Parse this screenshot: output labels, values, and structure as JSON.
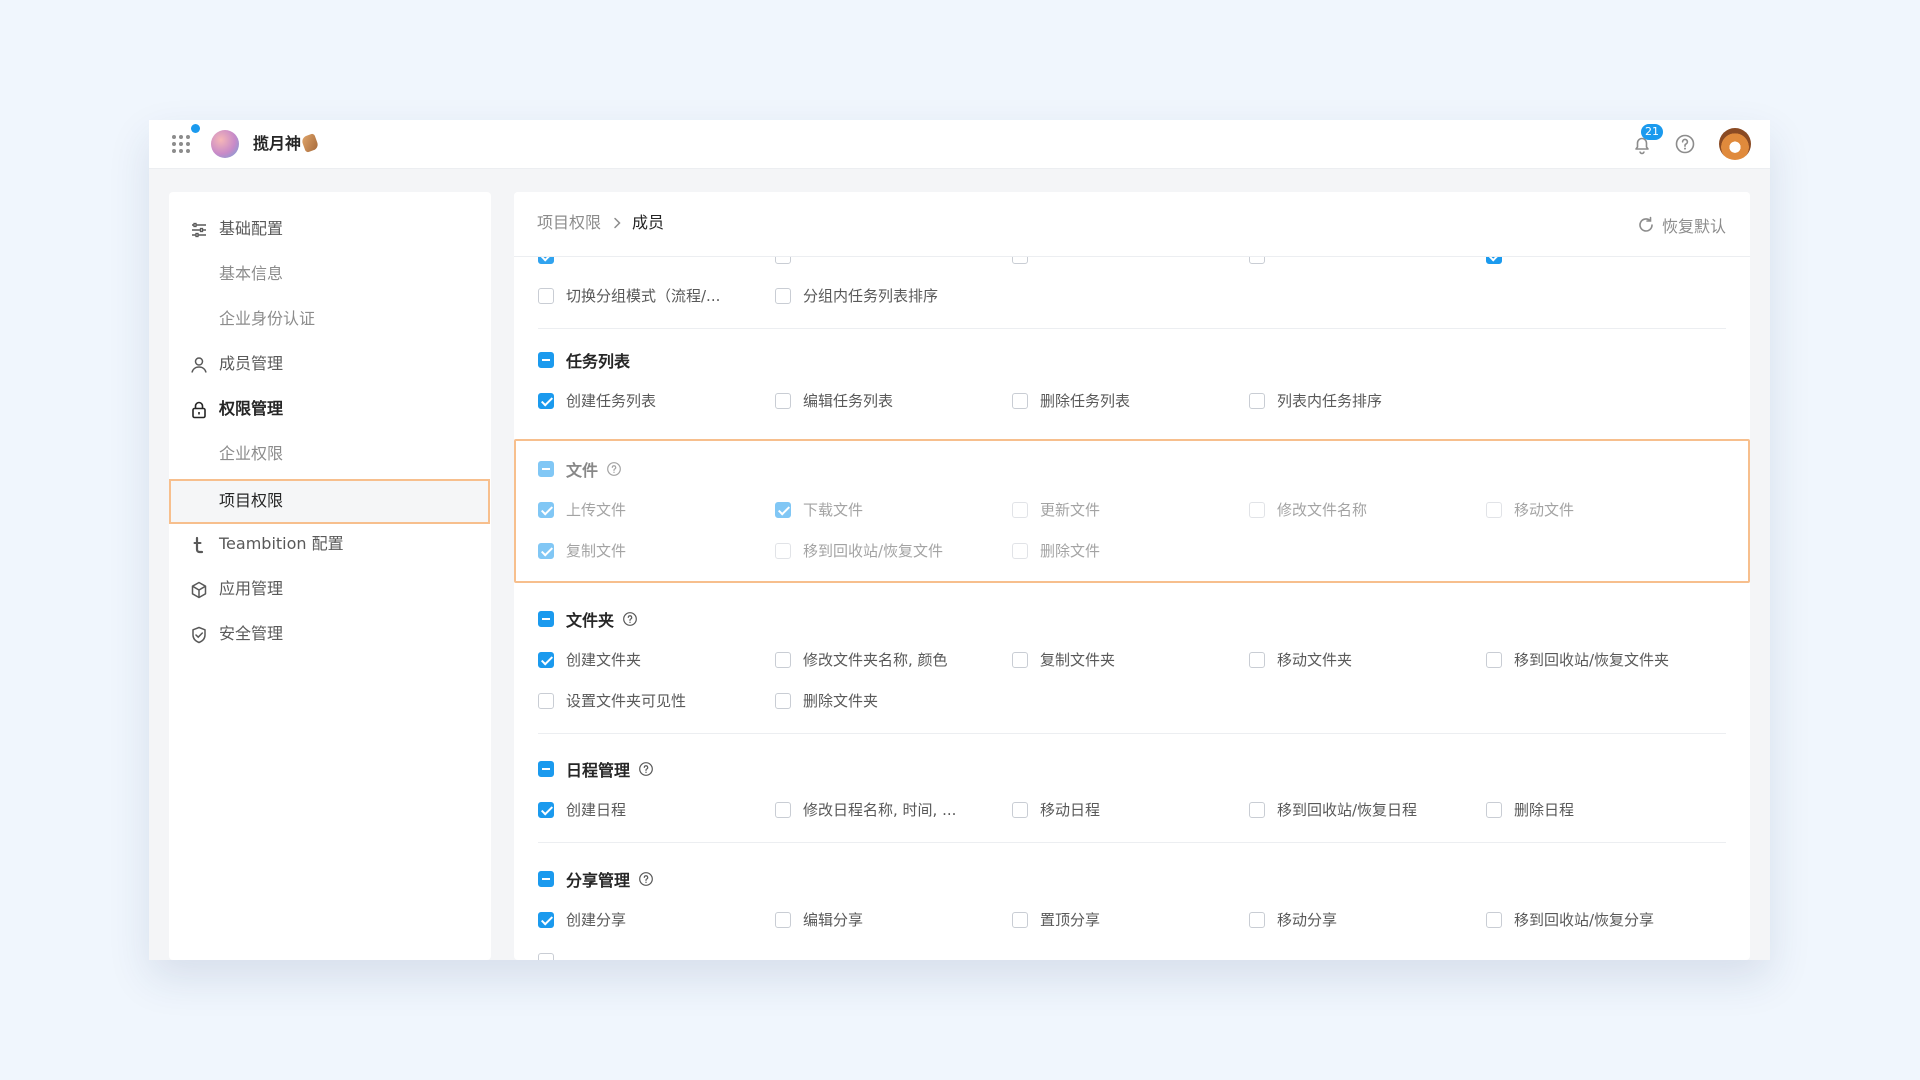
{
  "topbar": {
    "org_name": "揽月神",
    "notification_count": "21"
  },
  "sidebar": {
    "items": [
      {
        "label": "基础配置"
      },
      {
        "label": "基本信息"
      },
      {
        "label": "企业身份认证"
      },
      {
        "label": "成员管理"
      },
      {
        "label": "权限管理"
      },
      {
        "label": "企业权限"
      },
      {
        "label": "项目权限"
      },
      {
        "label": "Teambition 配置"
      },
      {
        "label": "应用管理"
      },
      {
        "label": "安全管理"
      }
    ]
  },
  "main": {
    "breadcrumb": {
      "parent": "项目权限",
      "current": "成员"
    },
    "reset_label": "恢复默认",
    "partial_row": [
      {
        "label": "切换分组模式（流程/...",
        "checked": false
      },
      {
        "label": "分组内任务列表排序",
        "checked": false
      }
    ],
    "sections": [
      {
        "title": "任务列表",
        "perms": [
          "创建任务列表",
          "编辑任务列表",
          "删除任务列表",
          "列表内任务排序"
        ]
      },
      {
        "title": "文件",
        "perms": [
          "上传文件",
          "下载文件",
          "更新文件",
          "修改文件名称",
          "移动文件",
          "复制文件",
          "移到回收站/恢复文件",
          "删除文件"
        ]
      },
      {
        "title": "文件夹",
        "perms": [
          "创建文件夹",
          "修改文件夹名称, 颜色",
          "复制文件夹",
          "移动文件夹",
          "移到回收站/恢复文件夹",
          "设置文件夹可见性",
          "删除文件夹"
        ]
      },
      {
        "title": "日程管理",
        "perms": [
          "创建日程",
          "修改日程名称, 时间, ...",
          "移动日程",
          "移到回收站/恢复日程",
          "删除日程"
        ]
      },
      {
        "title": "分享管理",
        "perms": [
          "创建分享",
          "编辑分享",
          "置顶分享",
          "移动分享",
          "移到回收站/恢复分享"
        ]
      }
    ]
  },
  "colors": {
    "accent": "#1b9aee",
    "highlight": "#f7bf8d"
  }
}
